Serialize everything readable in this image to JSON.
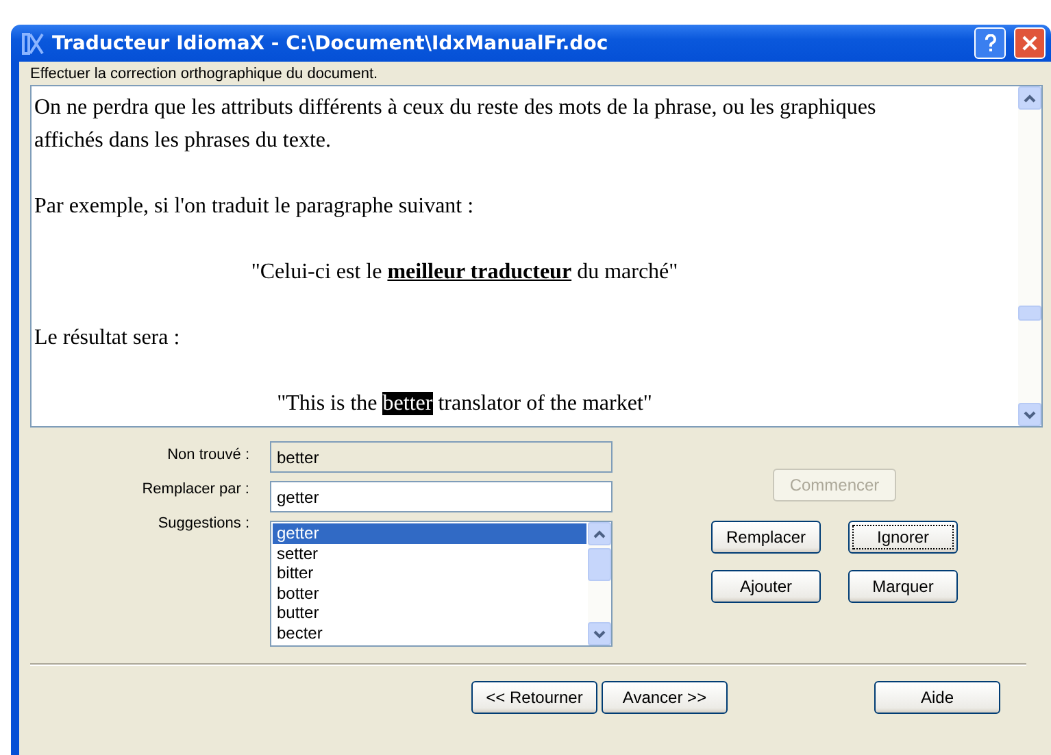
{
  "window": {
    "title": "Traducteur IdiomaX - C:\\Document\\IdxManualFr.doc"
  },
  "instruction": "Effectuer la correction orthographique du document.",
  "document": {
    "paragraphs": [
      {
        "kind": "plain",
        "parts": [
          {
            "text": "On ne perdra que les attributs différents à ceux du reste des mots de la phrase, ou les graphiques affichés dans les phrases du texte.",
            "highlighted": false
          }
        ]
      },
      {
        "kind": "plain",
        "parts": [
          {
            "text": "Par exemple, si l'on traduit le paragraphe suivant :",
            "highlighted": false
          }
        ]
      },
      {
        "kind": "centered",
        "parts": [
          {
            "text": "\"Celui-ci est le **meilleur traducteur** du marché\"",
            "highlighted": false
          }
        ]
      },
      {
        "kind": "plain",
        "parts": [
          {
            "text": "Le résultat sera :",
            "highlighted": false
          }
        ]
      },
      {
        "kind": "centered",
        "parts": [
          {
            "text": "\"This is the ",
            "highlighted": false
          },
          {
            "text": "better",
            "highlighted": true
          },
          {
            "text": " translator of the market\"",
            "highlighted": false
          }
        ]
      }
    ]
  },
  "fields": {
    "not_found": {
      "label": "Non trouvé :",
      "value": "better"
    },
    "replace_with": {
      "label": "Remplacer par :",
      "value": "getter"
    }
  },
  "suggestions": {
    "label": "Suggestions :",
    "items": [
      {
        "text": "getter",
        "selected": true
      },
      {
        "text": "setter",
        "selected": false
      },
      {
        "text": "bitter",
        "selected": false
      },
      {
        "text": "botter",
        "selected": false
      },
      {
        "text": "butter",
        "selected": false
      },
      {
        "text": "becter",
        "selected": false
      }
    ]
  },
  "start_button": {
    "label": "Commencer",
    "disabled": true
  },
  "action_buttons": [
    {
      "label": "Remplacer",
      "focused": false
    },
    {
      "label": "Ignorer",
      "focused": true
    },
    {
      "label": "Ajouter",
      "focused": false
    },
    {
      "label": "Marquer",
      "focused": false
    }
  ],
  "footer_buttons": {
    "back": "<< Retourner",
    "next": "Avancer >>",
    "help": "Aide"
  }
}
